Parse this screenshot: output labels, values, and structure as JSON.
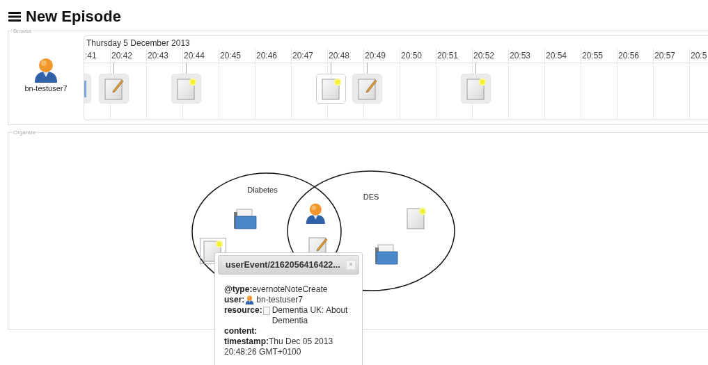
{
  "header": {
    "title": "New Episode"
  },
  "browse": {
    "legend": "Browse",
    "user": {
      "name": "bn-testuser7"
    },
    "timeline": {
      "date": "Thursday 5 December 2013",
      "ticks": [
        {
          "label": ":41",
          "events": [
            {
              "kind": "cut",
              "selected": false
            }
          ]
        },
        {
          "label": "20:42",
          "events": [
            {
              "kind": "edit",
              "selected": false
            }
          ]
        },
        {
          "label": "20:43"
        },
        {
          "label": "20:44",
          "events": [
            {
              "kind": "create",
              "selected": false
            }
          ]
        },
        {
          "label": "20:45"
        },
        {
          "label": "20:46"
        },
        {
          "label": "20:47"
        },
        {
          "label": "20:48",
          "events": [
            {
              "kind": "create",
              "selected": true
            }
          ]
        },
        {
          "label": "20:49",
          "events": [
            {
              "kind": "edit",
              "selected": false
            }
          ]
        },
        {
          "label": "20:50"
        },
        {
          "label": "20:51"
        },
        {
          "label": "20:52",
          "events": [
            {
              "kind": "create",
              "selected": false
            }
          ]
        },
        {
          "label": "20:53"
        },
        {
          "label": "20:54"
        },
        {
          "label": "20:55"
        },
        {
          "label": "20:56"
        },
        {
          "label": "20:57"
        },
        {
          "label": "20:5"
        }
      ]
    }
  },
  "organize": {
    "legend": "Organize",
    "sets": [
      {
        "label": "Diabetes",
        "items": [
          {
            "kind": "folder",
            "selected": false
          },
          {
            "kind": "create",
            "selected": true
          }
        ]
      },
      {
        "label": "DES",
        "items": [
          {
            "kind": "create",
            "selected": false
          },
          {
            "kind": "folder",
            "selected": false
          }
        ]
      }
    ],
    "shared": [
      {
        "kind": "user",
        "selected": false
      },
      {
        "kind": "edit",
        "selected": false
      }
    ]
  },
  "popup": {
    "title": "userEvent/2162056416422...",
    "close": "×",
    "fields": [
      {
        "kind": "text",
        "text": "**@type:**evernoteNoteCreate"
      },
      {
        "kind": "user",
        "label": "user:",
        "value": "bn-testuser7"
      },
      {
        "kind": "resource",
        "label": "resource:",
        "value": "Dementia UK: About Dementia"
      },
      {
        "kind": "text",
        "text": "**content:**"
      },
      {
        "kind": "text",
        "text": "**timestamp:**Thu Dec 05 2013 20:48:26 GMT+0100"
      }
    ]
  }
}
